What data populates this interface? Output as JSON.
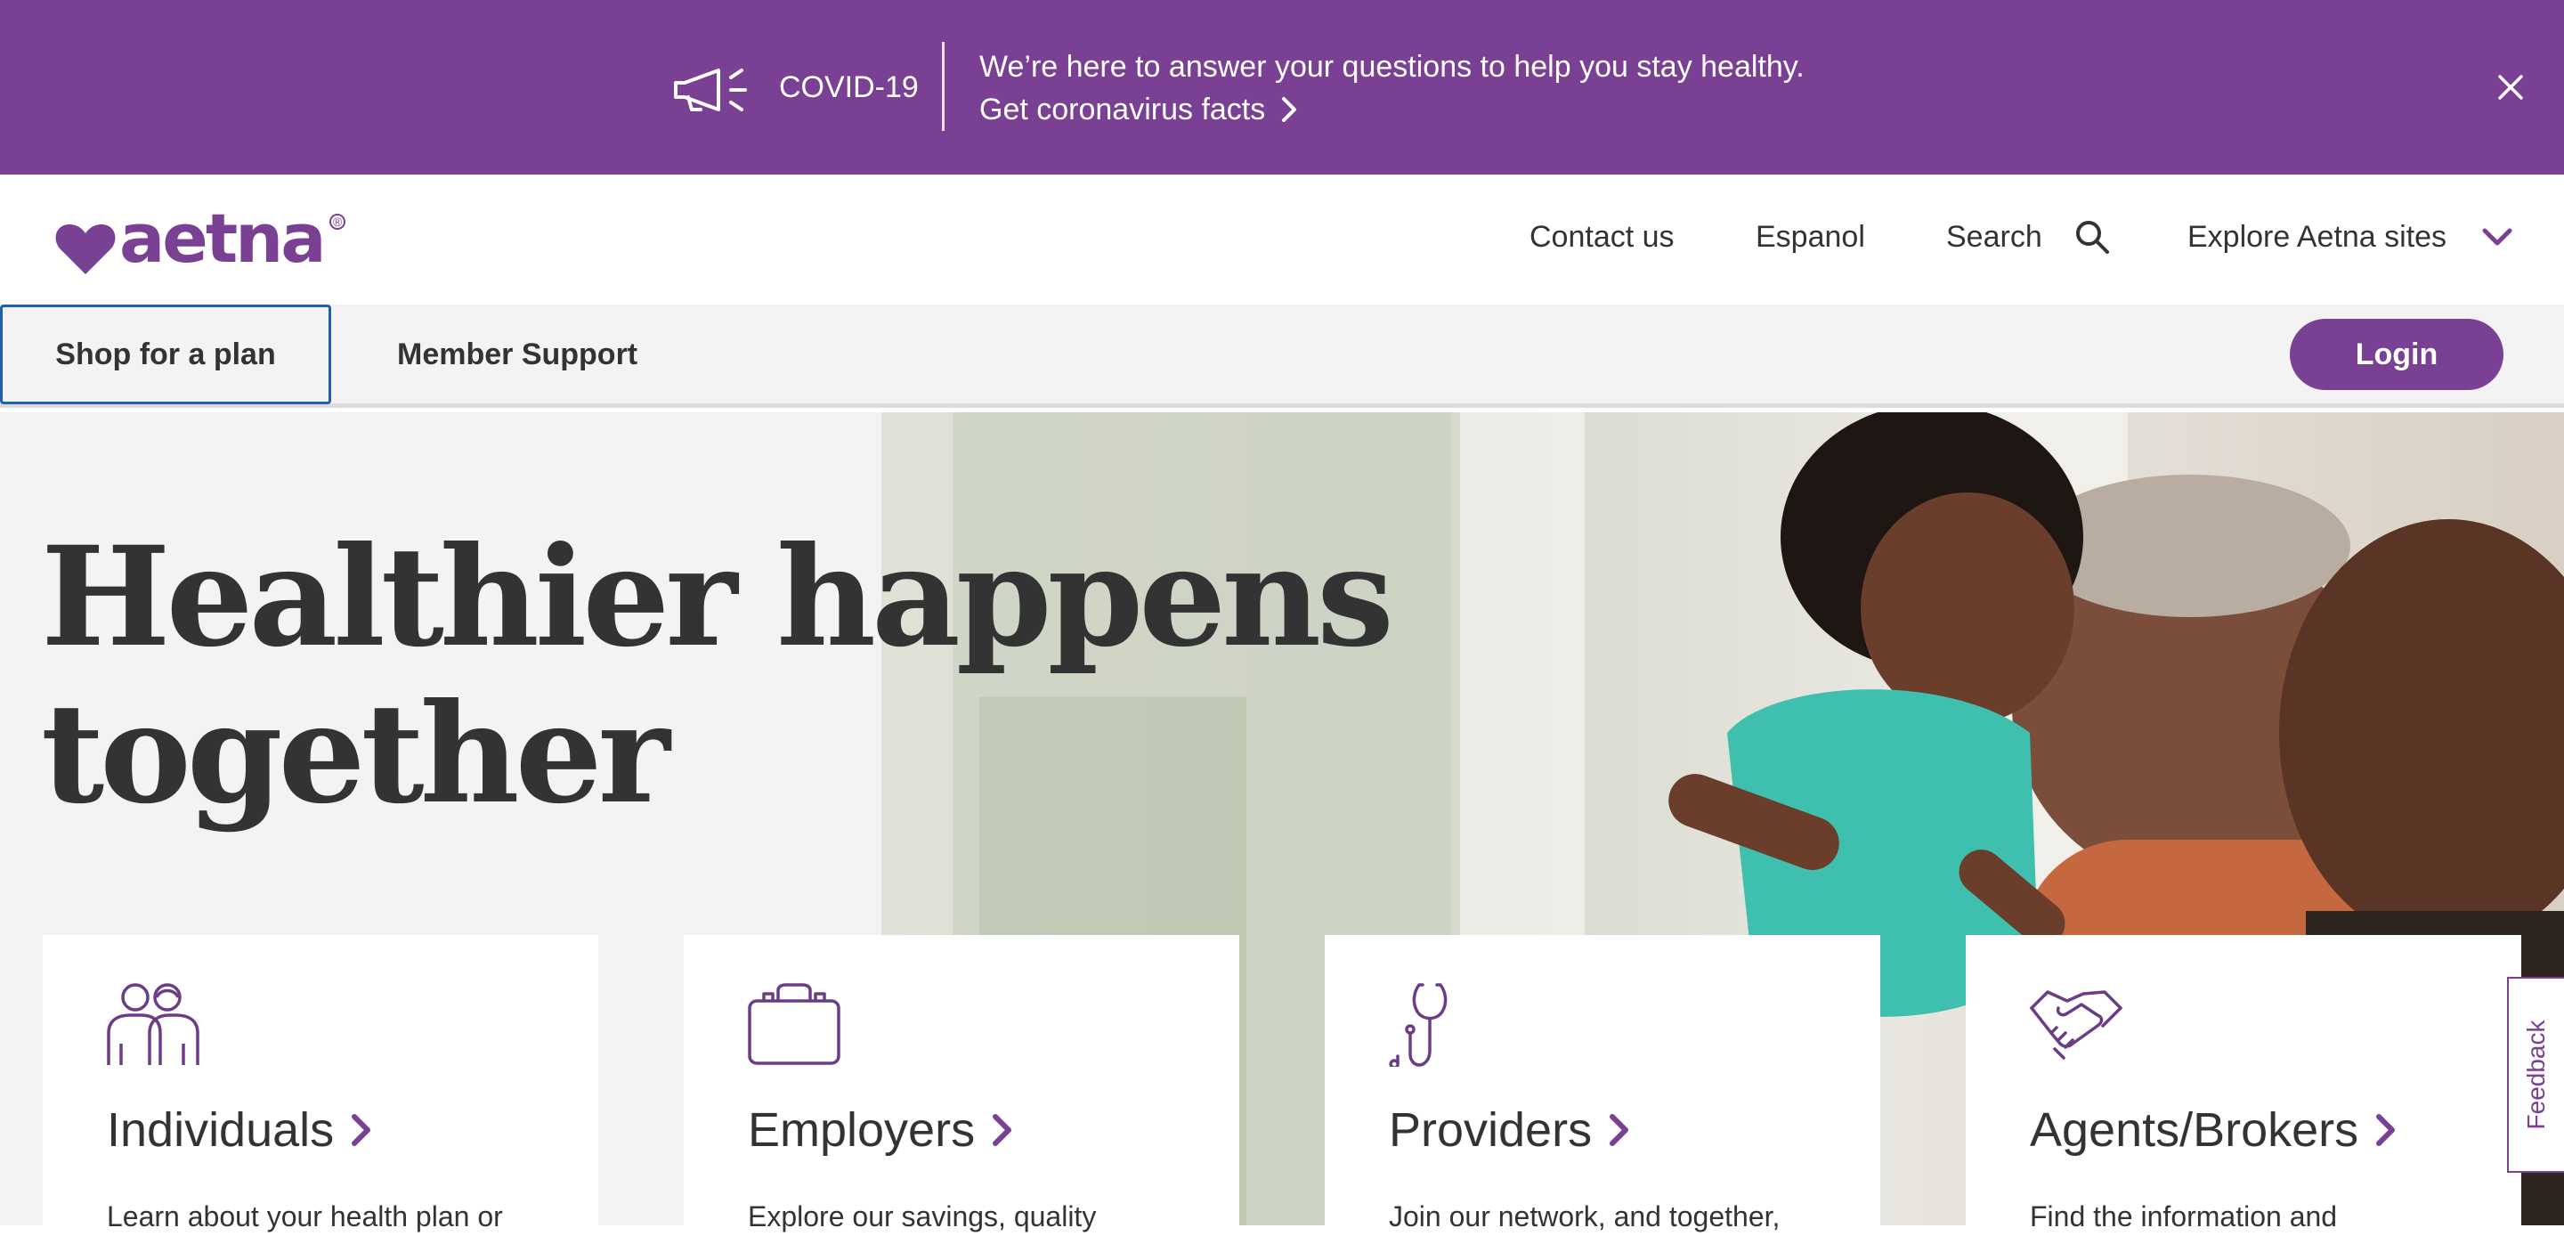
{
  "banner": {
    "label": "COVID-19",
    "message": "We’re here to answer your questions to help you stay healthy.",
    "link_text": "Get coronavirus facts"
  },
  "header": {
    "logo_text": "aetna",
    "logo_reg": "®",
    "contact": "Contact us",
    "espanol": "Espanol",
    "search": "Search",
    "explore": "Explore Aetna sites"
  },
  "subnav": {
    "shop": "Shop for a plan",
    "member": "Member Support",
    "login": "Login"
  },
  "hero": {
    "line1": "Healthier happens",
    "line2": "together"
  },
  "cards": [
    {
      "title": "Individuals",
      "desc": "Learn about your health plan or"
    },
    {
      "title": "Employers",
      "desc": "Explore our savings, quality"
    },
    {
      "title": "Providers",
      "desc": "Join our network, and together,"
    },
    {
      "title": "Agents/Brokers",
      "desc": "Find the information and"
    }
  ],
  "feedback": "Feedback",
  "colors": {
    "brand": "#7a4093",
    "text": "#333333",
    "focus": "#1f5fb4"
  }
}
